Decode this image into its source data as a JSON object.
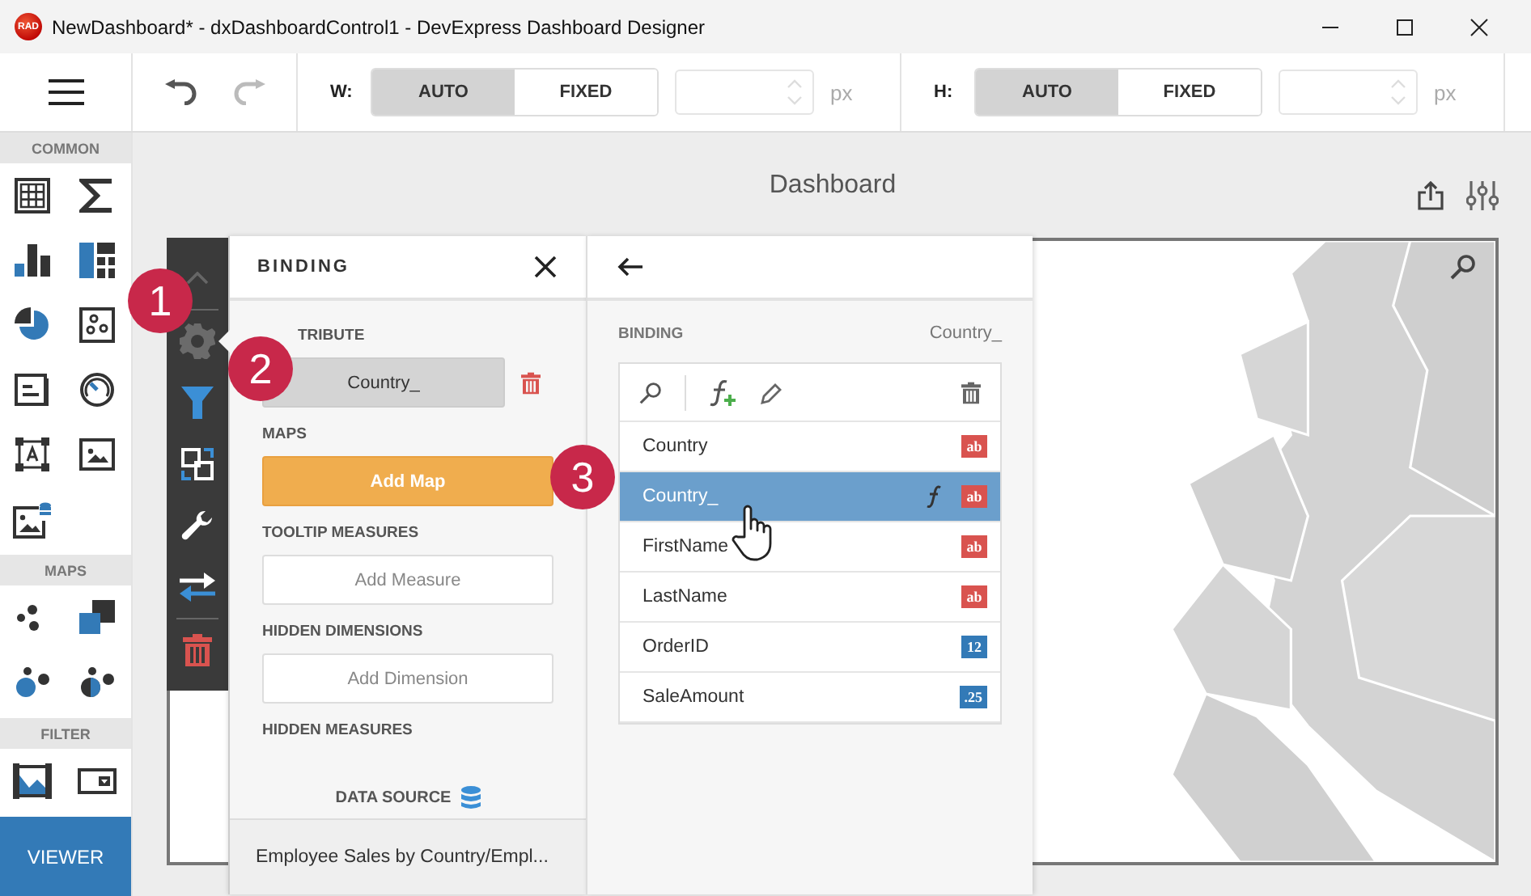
{
  "window": {
    "app_icon": "RAD",
    "title": "NewDashboard* - dxDashboardControl1 - DevExpress Dashboard Designer"
  },
  "toolbar": {
    "undo": {
      "disabled": false
    },
    "redo": {
      "disabled": true
    },
    "sizes": [
      {
        "label": "W:",
        "modes": [
          {
            "label": "AUTO",
            "selected": true
          },
          {
            "label": "FIXED",
            "selected": false
          }
        ],
        "unit": "px"
      },
      {
        "label": "H:",
        "modes": [
          {
            "label": "AUTO",
            "selected": true
          },
          {
            "label": "FIXED",
            "selected": false
          }
        ],
        "unit": "px"
      }
    ]
  },
  "toolbox": {
    "sections": [
      {
        "title": "COMMON",
        "items": [
          {
            "kind": "grid"
          },
          {
            "kind": "sum"
          },
          {
            "kind": "bar"
          },
          {
            "kind": "treemap"
          },
          {
            "kind": "pie"
          },
          {
            "kind": "scatter"
          },
          {
            "kind": "card"
          },
          {
            "kind": "gauge"
          },
          {
            "kind": "text"
          },
          {
            "kind": "image"
          },
          {
            "kind": "bound-image"
          }
        ]
      },
      {
        "title": "MAPS",
        "items": [
          {
            "kind": "dot-map"
          },
          {
            "kind": "squares"
          },
          {
            "kind": "bubble-map"
          },
          {
            "kind": "pie-map"
          }
        ]
      },
      {
        "title": "FILTER",
        "items": [
          {
            "kind": "range"
          },
          {
            "kind": "combo"
          }
        ]
      }
    ],
    "viewer_button": "VIEWER"
  },
  "dashboard": {
    "title": "Dashboard"
  },
  "item_menu": [
    {
      "kind": "up",
      "selected": false
    },
    {
      "kind": "gear",
      "selected": true
    },
    {
      "kind": "filter",
      "selected": false
    },
    {
      "kind": "interactivity",
      "selected": false
    },
    {
      "kind": "wrench",
      "selected": false
    },
    {
      "kind": "convert",
      "selected": false
    },
    {
      "kind": "delete",
      "selected": false
    }
  ],
  "binding_panel": {
    "title": "BINDING",
    "sections": [
      {
        "kind": "attribute",
        "title": "TRIBUTE",
        "value": "Country_"
      },
      {
        "kind": "add",
        "title": "MAPS",
        "button": "Add Map",
        "primary": true
      },
      {
        "kind": "add",
        "title": "TOOLTIP MEASURES",
        "button": "Add Measure",
        "primary": false
      },
      {
        "kind": "add",
        "title": "HIDDEN DIMENSIONS",
        "button": "Add Dimension",
        "primary": false
      },
      {
        "kind": "label",
        "title": "HIDDEN MEASURES"
      }
    ],
    "data_source": "DATA SOURCE",
    "footer": "Employee Sales by Country/Empl..."
  },
  "field_panel": {
    "label": "BINDING",
    "current": "Country_",
    "fields": [
      {
        "name": "Country",
        "badge": "ab",
        "color": "#d9534f",
        "calculated": false,
        "selected": false
      },
      {
        "name": "Country_",
        "badge": "ab",
        "color": "#d9534f",
        "calculated": true,
        "selected": true
      },
      {
        "name": "FirstName",
        "badge": "ab",
        "color": "#d9534f",
        "calculated": false,
        "selected": false
      },
      {
        "name": "LastName",
        "badge": "ab",
        "color": "#d9534f",
        "calculated": false,
        "selected": false
      },
      {
        "name": "OrderID",
        "badge": "12",
        "color": "#337ab7",
        "calculated": false,
        "selected": false
      },
      {
        "name": "SaleAmount",
        "badge": ".25",
        "color": "#337ab7",
        "calculated": false,
        "selected": false
      }
    ]
  },
  "callouts": [
    "1",
    "2",
    "3"
  ]
}
